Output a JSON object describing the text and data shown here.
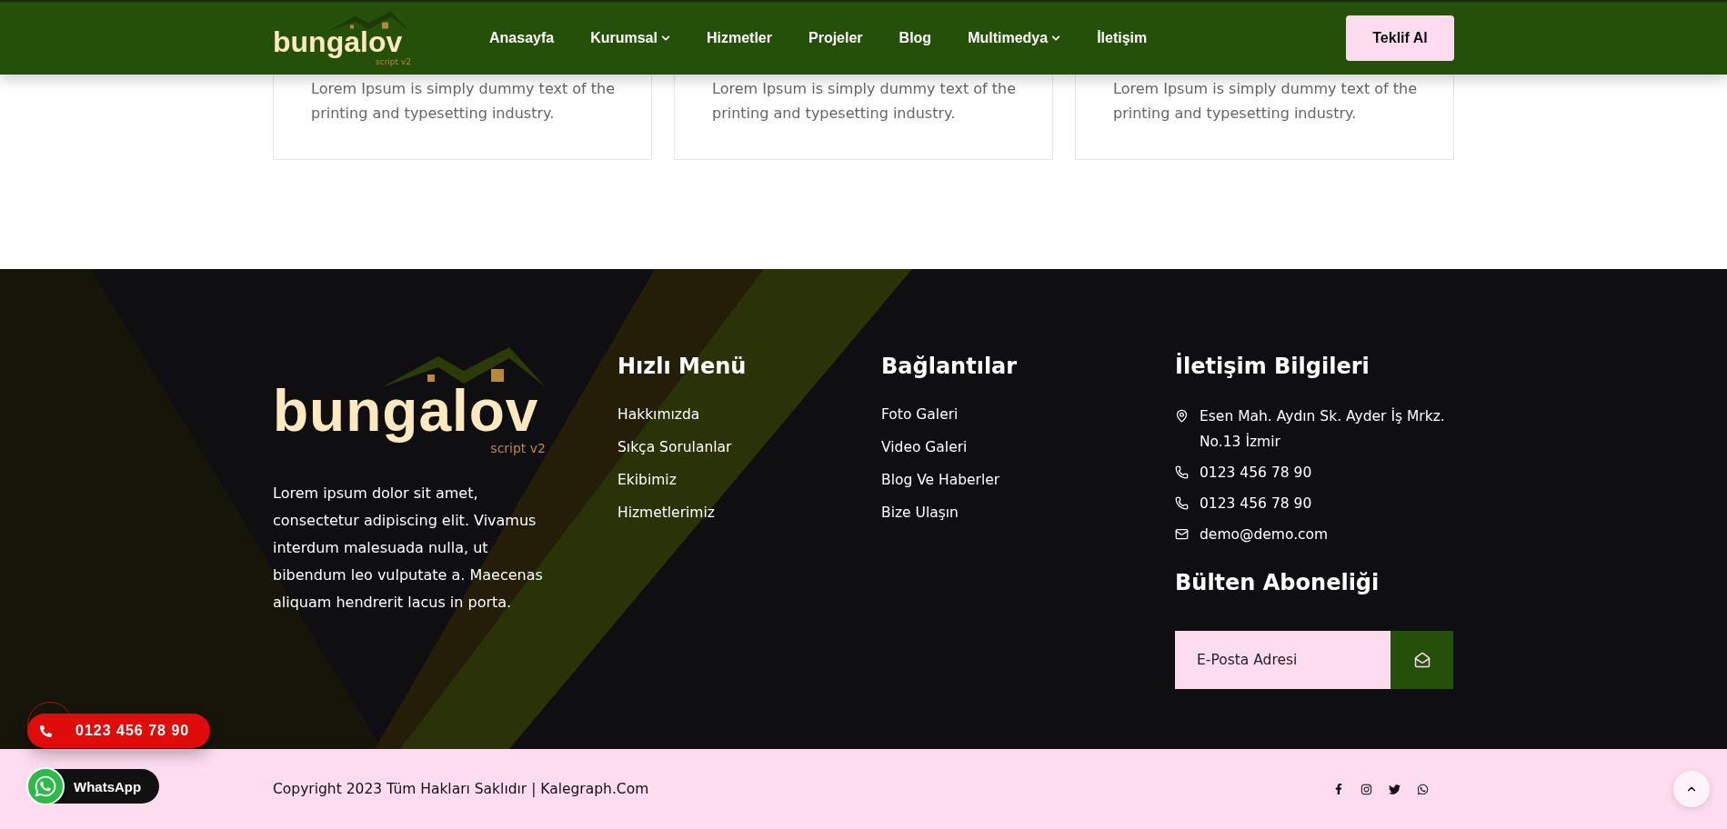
{
  "header": {
    "logo": {
      "name": "bungalov",
      "tagline": "script v2"
    },
    "nav": [
      {
        "label": "Anasayfa",
        "dropdown": false
      },
      {
        "label": "Kurumsal",
        "dropdown": true
      },
      {
        "label": "Hizmetler",
        "dropdown": false
      },
      {
        "label": "Projeler",
        "dropdown": false
      },
      {
        "label": "Blog",
        "dropdown": false
      },
      {
        "label": "Multimedya",
        "dropdown": true
      },
      {
        "label": "İletişim",
        "dropdown": false
      }
    ],
    "cta": "Teklif Al"
  },
  "cards": [
    {
      "text": "Lorem Ipsum is simply dummy text of the printing and typesetting industry."
    },
    {
      "text": "Lorem Ipsum is simply dummy text of the printing and typesetting industry."
    },
    {
      "text": "Lorem Ipsum is simply dummy text of the printing and typesetting industry."
    }
  ],
  "footer": {
    "about": {
      "logo": {
        "name": "bungalov",
        "tagline": "script v2"
      },
      "text": "Lorem ipsum dolor sit amet, consectetur adipiscing elit. Vivamus interdum malesuada nulla, ut bibendum leo vulputate a. Maecenas aliquam hendrerit lacus in porta."
    },
    "quick_menu": {
      "title": "Hızlı Menü",
      "links": [
        "Hakkımızda",
        "Sıkça Sorulanlar",
        "Ekibimiz",
        "Hizmetlerimiz"
      ]
    },
    "links": {
      "title": "Bağlantılar",
      "links": [
        "Foto Galeri",
        "Video Galeri",
        "Blog Ve Haberler",
        "Bize Ulaşın"
      ]
    },
    "contact": {
      "title": "İletişim Bilgileri",
      "items": [
        {
          "kind": "address",
          "text": "Esen Mah. Aydın Sk. Ayder İş Mrkz. No.13 İzmir"
        },
        {
          "kind": "phone",
          "text": "0123 456 78 90"
        },
        {
          "kind": "phone",
          "text": "0123 456 78 90"
        },
        {
          "kind": "email",
          "text": "demo@demo.com"
        }
      ]
    },
    "newsletter": {
      "title": "Bülten Aboneliği",
      "placeholder": "E-Posta Adresi"
    }
  },
  "bottom_bar": {
    "copyright": "Copyright 2023 Tüm Hakları Saklıdır | Kalegraph.Com",
    "social": [
      {
        "kind": "facebook"
      },
      {
        "kind": "instagram"
      },
      {
        "kind": "twitter"
      },
      {
        "kind": "whatsapp"
      }
    ]
  },
  "floating": {
    "phone": "0123 456 78 90",
    "whatsapp": "WhatsApp"
  }
}
